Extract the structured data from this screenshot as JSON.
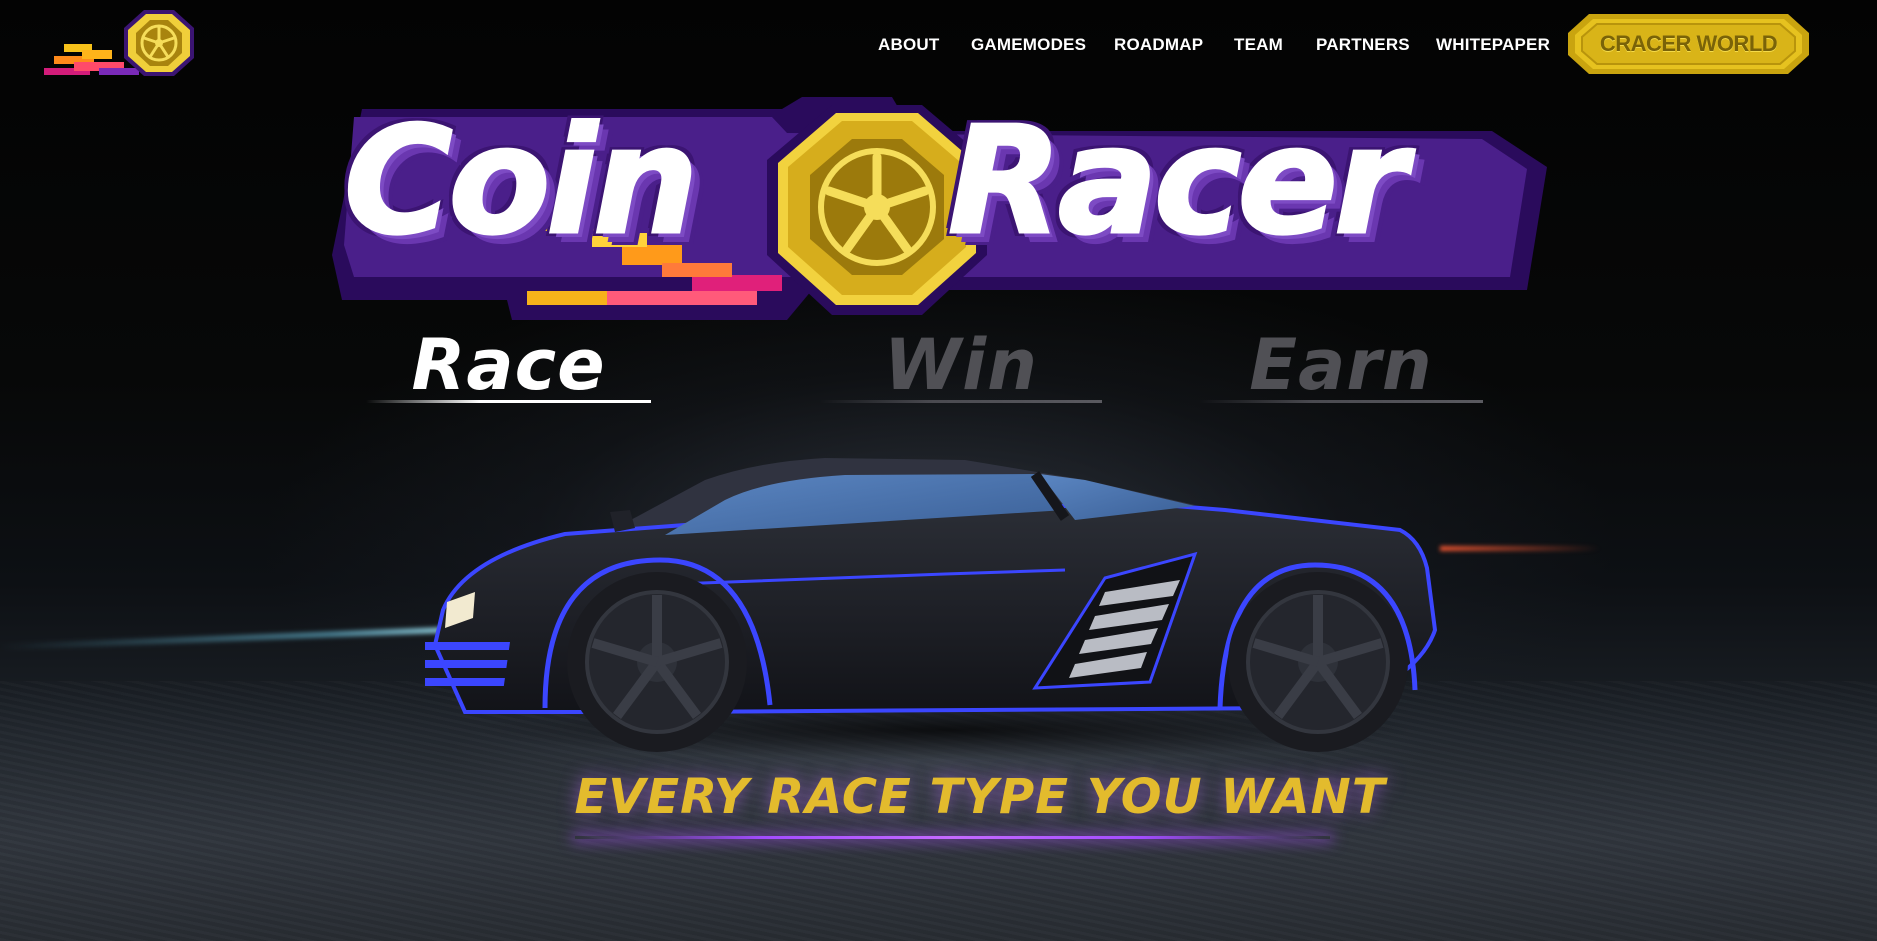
{
  "header": {
    "logo_icon": "coin-wheel-logo-icon",
    "nav": [
      {
        "label": "ABOUT"
      },
      {
        "label": "GAMEMODES"
      },
      {
        "label": "ROADMAP"
      },
      {
        "label": "TEAM"
      },
      {
        "label": "PARTNERS"
      },
      {
        "label": "WHITEPAPER"
      }
    ],
    "cta_label": "CRACER WORLD"
  },
  "hero": {
    "logo_left": "Coin",
    "logo_right": "Racer",
    "logo_icon": "coin-wheel-icon",
    "tabs": [
      {
        "label": "Race",
        "active": true
      },
      {
        "label": "Win",
        "active": false
      },
      {
        "label": "Earn",
        "active": false
      }
    ],
    "tagline": "EVERY RACE TYPE YOU WANT"
  },
  "colors": {
    "gold": "#e3bb2d",
    "purple": "#6a37b0",
    "neon_blue": "#3b46ff",
    "background": "#050505"
  }
}
